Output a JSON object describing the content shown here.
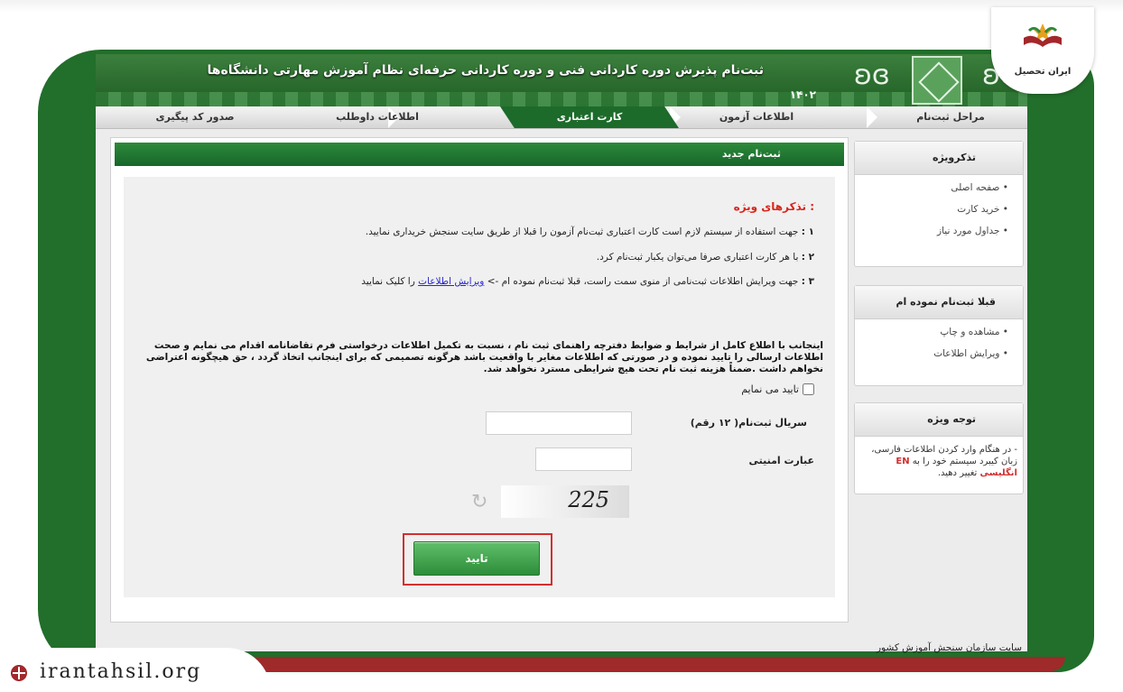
{
  "banner": {
    "title": "ثبت‌نام پذیرش دوره کاردانی فنی و دوره کاردانی حرفه‌ای نظام آموزش مهارتی دانشگاه‌ها",
    "year": "۱۴۰۲"
  },
  "steps": [
    {
      "label": "مراحل ثبت‌نام"
    },
    {
      "label": "اطلاعات آزمون"
    },
    {
      "label": "کارت اعتباری"
    },
    {
      "label": "اطلاعات داوطلب"
    },
    {
      "label": "صدور کد پیگیری"
    }
  ],
  "main": {
    "header": "ثبت‌نام جدید",
    "notice_title": "تذکرهای ویژه :",
    "notes": [
      {
        "num": "۱ :",
        "text": "جهت استفاده از سیستم لازم است کارت اعتباری ثبت‌نام آزمون را قبلا از طریق سایت سنجش خریداری نمایید."
      },
      {
        "num": "۲ :",
        "text": "با هر کارت اعتباری صرفا می‌توان یکبار ثبت‌نام کرد."
      },
      {
        "num": "۳ :",
        "text": "جهت ویرایش اطلاعات ثبت‌نامی از منوی سمت راست، قبلا ثبت‌نام نموده ام ->",
        "link": "ویرایش اطلاعات",
        "suffix": "را کلیک نمایید"
      }
    ],
    "consent": "اینجانب با اطلاع کامل از شرایط و ضوابط دفترچه راهنمای ثبت نام ، نسبت به تکمیل اطلاعات درخواستی فرم تقاضانامه اقدام می نمایم و صحت اطلاعات ارسالی را تایید نموده و در صورتی که اطلاعات مغایر با واقعیت باشد هرگونه تصمیمی که برای اینجانب اتخاذ گردد ، حق هیچگونه اعتراضی نخواهم داشت .ضمناً هزینه ثبت نام تحت هیچ شرایطی مسترد نخواهد شد.",
    "confirm_label": "تایید می نمایم",
    "serial_label": "سریال ثبت‌نام( ۱۲ رقم)",
    "security_label": "عبارت امنیتی",
    "captcha_text": "225",
    "submit_label": "تایید"
  },
  "sidebar": {
    "boxes": [
      {
        "title": "تذکرویژه",
        "items": [
          "صفحه اصلی",
          "خرید کارت",
          "جداول مورد نیاز"
        ]
      },
      {
        "title": "قبلا ثبت‌نام نموده ام",
        "items": [
          "مشاهده و چاپ",
          "ویرایش اطلاعات"
        ]
      },
      {
        "title": "توجه ویژه",
        "text": "- در هنگام وارد کردن اطلاعات فارسی، زبان کیبرد سیستم خود را به",
        "en": "EN انگلیسی",
        "text_after": "تغییر دهید."
      }
    ]
  },
  "footer": {
    "text": "سایت سازمان سنجش آموزش کشور"
  },
  "brand": {
    "logo_text": "ایران تحصیل",
    "watermark": "irantahsil.org"
  },
  "colors": {
    "primary_green": "#1c6b2a",
    "frame_green": "#226e2b",
    "accent_red": "#d32f2f"
  }
}
